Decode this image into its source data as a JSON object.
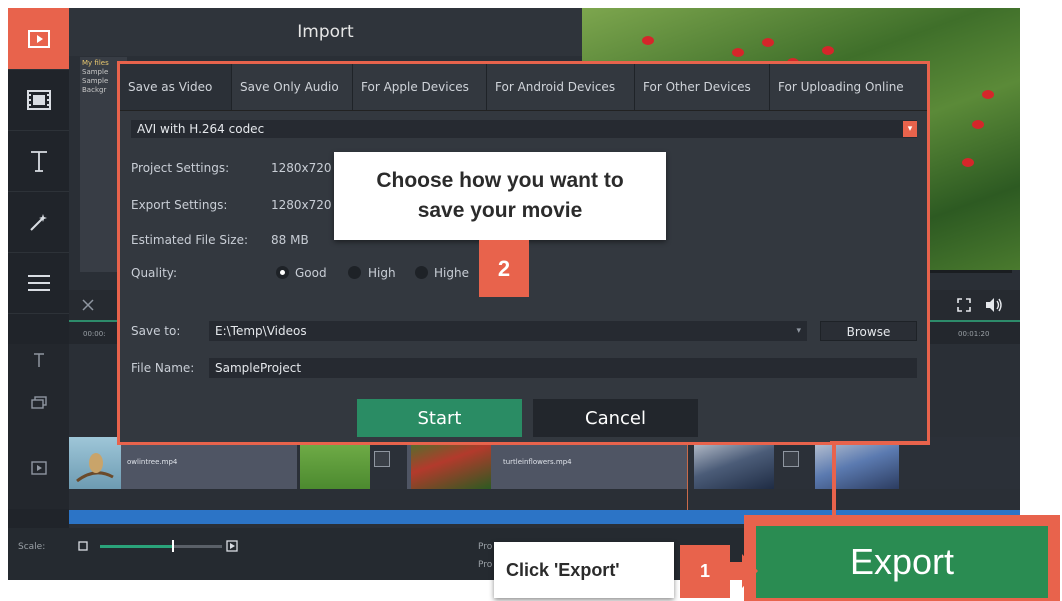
{
  "header": {
    "title": "Import"
  },
  "files": [
    "My files",
    "Sample",
    "Sample",
    "Backgr"
  ],
  "dialog": {
    "tabs": [
      "Save as Video",
      "Save Only Audio",
      "For Apple Devices",
      "For Android Devices",
      "For Other Devices",
      "For Uploading Online"
    ],
    "active_tab": "Save as Video",
    "format": "AVI with H.264 codec",
    "project_settings_label": "Project Settings:",
    "project_settings_value": "1280x720",
    "export_settings_label": "Export Settings:",
    "export_settings_value": "1280x720",
    "file_size_label": "Estimated File Size:",
    "file_size_value": "88 MB",
    "quality_label": "Quality:",
    "quality_options": [
      "Good",
      "High",
      "Highe"
    ],
    "quality_selected": "Good",
    "save_to_label": "Save to:",
    "save_to_value": "E:\\Temp\\Videos",
    "browse_label": "Browse",
    "file_name_label": "File Name:",
    "file_name_value": "SampleProject",
    "start_label": "Start",
    "cancel_label": "Cancel"
  },
  "callouts": {
    "choose_text_line1": "Choose how you want to",
    "choose_text_line2": "save your movie",
    "step2": "2",
    "click_export": "Click 'Export'",
    "step1": "1"
  },
  "timeline": {
    "ruler_start": "00:00:",
    "ruler_end": "00:01:20",
    "clips": [
      "owlintree.mp4",
      "turtleinflowers.mp4"
    ]
  },
  "bottombar": {
    "scale_label": "Scale:",
    "pro_labels": [
      "Pro",
      "Pro"
    ]
  },
  "export_button": "Export",
  "colors": {
    "accent": "#e8634c",
    "export_green": "#2a8c52",
    "start_green": "#2a8c64",
    "timeline_blue": "#2c74c6"
  }
}
